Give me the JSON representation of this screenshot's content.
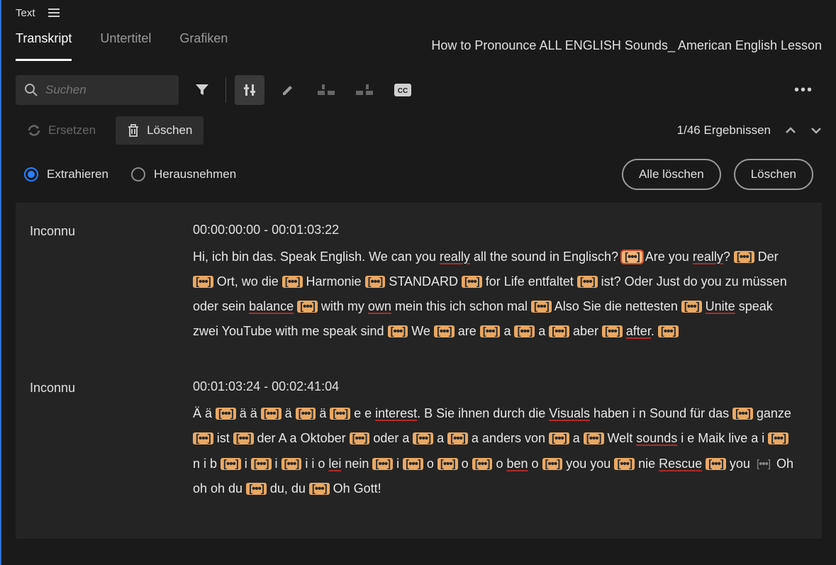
{
  "panel_title": "Text",
  "tabs": [
    "Transkript",
    "Untertitel",
    "Grafiken"
  ],
  "active_tab": 0,
  "clip_title": "How to Pronounce ALL ENGLISH Sounds_ American English Lesson",
  "search": {
    "placeholder": "Suchen"
  },
  "replace_label": "Ersetzen",
  "delete_label": "Löschen",
  "results_label": "1/46 Ergebnissen",
  "radios": {
    "extract": "Extrahieren",
    "remove": "Herausnehmen"
  },
  "buttons": {
    "delete_all": "Alle löschen",
    "delete": "Löschen"
  },
  "segments": [
    {
      "speaker": "Inconnu",
      "timecode": "00:00:00:00 - 00:01:03:22",
      "tokens": [
        {
          "t": "Hi, ich bin das. Speak English. We can you "
        },
        {
          "t": "really",
          "u": 1
        },
        {
          "t": " all the sound in Englisch? "
        },
        {
          "m": 1,
          "sel": 1
        },
        {
          "t": " Are you "
        },
        {
          "t": "really",
          "u": 1
        },
        {
          "t": "? "
        },
        {
          "m": 1
        },
        {
          "t": " Der "
        },
        {
          "m": 1
        },
        {
          "t": " Ort, wo die "
        },
        {
          "m": 1
        },
        {
          "t": " Harmonie "
        },
        {
          "m": 1
        },
        {
          "t": " STANDARD "
        },
        {
          "m": 1
        },
        {
          "t": " for Life entfaltet "
        },
        {
          "m": 1
        },
        {
          "t": " ist? Oder Just do you zu müssen oder sein "
        },
        {
          "t": "balance",
          "u": 1
        },
        {
          "t": " "
        },
        {
          "m": 1
        },
        {
          "t": " with my "
        },
        {
          "t": "own",
          "u": 1
        },
        {
          "t": " mein this ich schon mal "
        },
        {
          "m": 1
        },
        {
          "t": " Also Sie die nettesten "
        },
        {
          "m": 1
        },
        {
          "t": " "
        },
        {
          "t": "Unite",
          "u": 1
        },
        {
          "t": " speak zwei YouTube with me speak sind "
        },
        {
          "m": 1
        },
        {
          "t": " We "
        },
        {
          "m": 1
        },
        {
          "t": " are "
        },
        {
          "m": 1
        },
        {
          "t": " a "
        },
        {
          "m": 1
        },
        {
          "t": " a "
        },
        {
          "m": 1
        },
        {
          "t": " aber "
        },
        {
          "m": 1
        },
        {
          "t": " "
        },
        {
          "t": "after",
          "u": 1
        },
        {
          "t": ". "
        },
        {
          "m": 1
        }
      ]
    },
    {
      "speaker": "Inconnu",
      "timecode": "00:01:03:24 - 00:02:41:04",
      "tokens": [
        {
          "t": "Ä ä "
        },
        {
          "m": 1
        },
        {
          "t": " ä ä "
        },
        {
          "m": 1
        },
        {
          "t": " ä "
        },
        {
          "m": 1
        },
        {
          "t": " ä "
        },
        {
          "m": 1
        },
        {
          "t": " e e "
        },
        {
          "t": "interest",
          "u": 1
        },
        {
          "t": ". B Sie ihnen durch die "
        },
        {
          "t": "Visuals",
          "u": 1
        },
        {
          "t": " haben i n Sound für das "
        },
        {
          "m": 1
        },
        {
          "t": " ganze "
        },
        {
          "m": 1
        },
        {
          "t": " ist "
        },
        {
          "m": 1
        },
        {
          "t": " der A a Oktober "
        },
        {
          "m": 1
        },
        {
          "t": " oder a "
        },
        {
          "m": 1
        },
        {
          "t": " a "
        },
        {
          "m": 1
        },
        {
          "t": " a anders von "
        },
        {
          "m": 1
        },
        {
          "t": " a "
        },
        {
          "m": 1
        },
        {
          "t": " Welt "
        },
        {
          "t": "sounds",
          "u": 1
        },
        {
          "t": " i e Maik live a i "
        },
        {
          "m": 1
        },
        {
          "t": " n i b "
        },
        {
          "m": 1
        },
        {
          "t": " i "
        },
        {
          "m": 1
        },
        {
          "t": " i "
        },
        {
          "m": 1
        },
        {
          "t": " i i o "
        },
        {
          "t": "lei",
          "u": 1
        },
        {
          "t": " nein "
        },
        {
          "m": 1
        },
        {
          "t": " i "
        },
        {
          "m": 1
        },
        {
          "t": " o "
        },
        {
          "m": 1
        },
        {
          "t": " o "
        },
        {
          "m": 1
        },
        {
          "t": " o "
        },
        {
          "t": "ben",
          "u": 1
        },
        {
          "t": " o "
        },
        {
          "m": 1
        },
        {
          "t": " you you "
        },
        {
          "m": 1
        },
        {
          "t": " nie "
        },
        {
          "t": "Rescue",
          "u": 1
        },
        {
          "t": " "
        },
        {
          "m": 1
        },
        {
          "t": " you "
        },
        {
          "m": 1,
          "gray": 1
        },
        {
          "t": " Oh oh oh du "
        },
        {
          "m": 1
        },
        {
          "t": " du, du "
        },
        {
          "m": 1
        },
        {
          "t": " Oh Gott!"
        }
      ]
    }
  ]
}
